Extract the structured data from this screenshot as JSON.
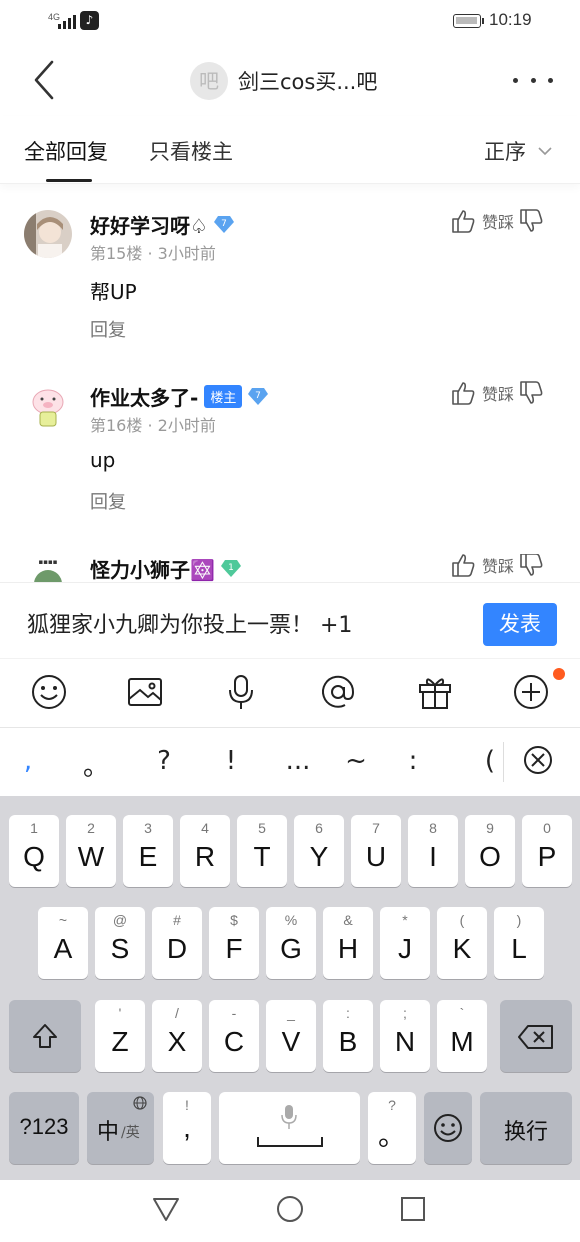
{
  "status_bar": {
    "network": "4G",
    "time": "10:19"
  },
  "header": {
    "forum_avatar_text": "吧",
    "title": "剑三cos买...吧"
  },
  "tabs": {
    "all_replies": "全部回复",
    "op_only": "只看楼主",
    "sort": "正序"
  },
  "posts": [
    {
      "username": "好好学习呀♤",
      "level": "7",
      "floor": "第15楼",
      "time": "3小时前",
      "content": "帮UP",
      "reply": "回复",
      "vote": "赞踩",
      "is_op": false,
      "op_label": "",
      "level_color": "#5aa3f0"
    },
    {
      "username": "作业太多了-",
      "level": "7",
      "floor": "第16楼",
      "time": "2小时前",
      "content": "up",
      "reply": "回复",
      "vote": "赞踩",
      "is_op": true,
      "op_label": "楼主",
      "level_color": "#5aa3f0"
    },
    {
      "username": "怪力小狮子🔯",
      "level": "1",
      "floor": "",
      "time": "",
      "content": "",
      "reply": "",
      "vote": "赞踩",
      "is_op": false,
      "op_label": "",
      "level_color": "#4fc99a"
    }
  ],
  "composer": {
    "text": "狐狸家小九卿为你投上一票！ +1",
    "publish": "发表"
  },
  "toolbar": [
    "emoji-icon",
    "image-icon",
    "microphone-icon",
    "mention-icon",
    "gift-icon",
    "plus-icon"
  ],
  "punctuation": [
    ",",
    "。",
    "?",
    "!",
    "...",
    "~",
    ":",
    "("
  ],
  "keyboard": {
    "row1": [
      {
        "hint": "1",
        "key": "Q"
      },
      {
        "hint": "2",
        "key": "W"
      },
      {
        "hint": "3",
        "key": "E"
      },
      {
        "hint": "4",
        "key": "R"
      },
      {
        "hint": "5",
        "key": "T"
      },
      {
        "hint": "6",
        "key": "Y"
      },
      {
        "hint": "7",
        "key": "U"
      },
      {
        "hint": "8",
        "key": "I"
      },
      {
        "hint": "9",
        "key": "O"
      },
      {
        "hint": "0",
        "key": "P"
      }
    ],
    "row2": [
      {
        "hint": "~",
        "key": "A"
      },
      {
        "hint": "@",
        "key": "S"
      },
      {
        "hint": "#",
        "key": "D"
      },
      {
        "hint": "$",
        "key": "F"
      },
      {
        "hint": "%",
        "key": "G"
      },
      {
        "hint": "&",
        "key": "H"
      },
      {
        "hint": "*",
        "key": "J"
      },
      {
        "hint": "(",
        "key": "K"
      },
      {
        "hint": ")",
        "key": "L"
      }
    ],
    "row3": [
      {
        "hint": "'",
        "key": "Z"
      },
      {
        "hint": "/",
        "key": "X"
      },
      {
        "hint": "-",
        "key": "C"
      },
      {
        "hint": "_",
        "key": "V"
      },
      {
        "hint": ":",
        "key": "B"
      },
      {
        "hint": ";",
        "key": "N"
      },
      {
        "hint": "`",
        "key": "M"
      }
    ],
    "numbers_key": "?123",
    "lang_key": "中",
    "lang_sub": "/英",
    "comma_hint": "!",
    "comma_key": ",",
    "period_hint": "?",
    "period_key": "。",
    "enter_key": "换行"
  },
  "colors": {
    "accent": "#3385ff",
    "notification_dot": "#ff5b1f",
    "keyboard_bg": "#d6d6da"
  }
}
